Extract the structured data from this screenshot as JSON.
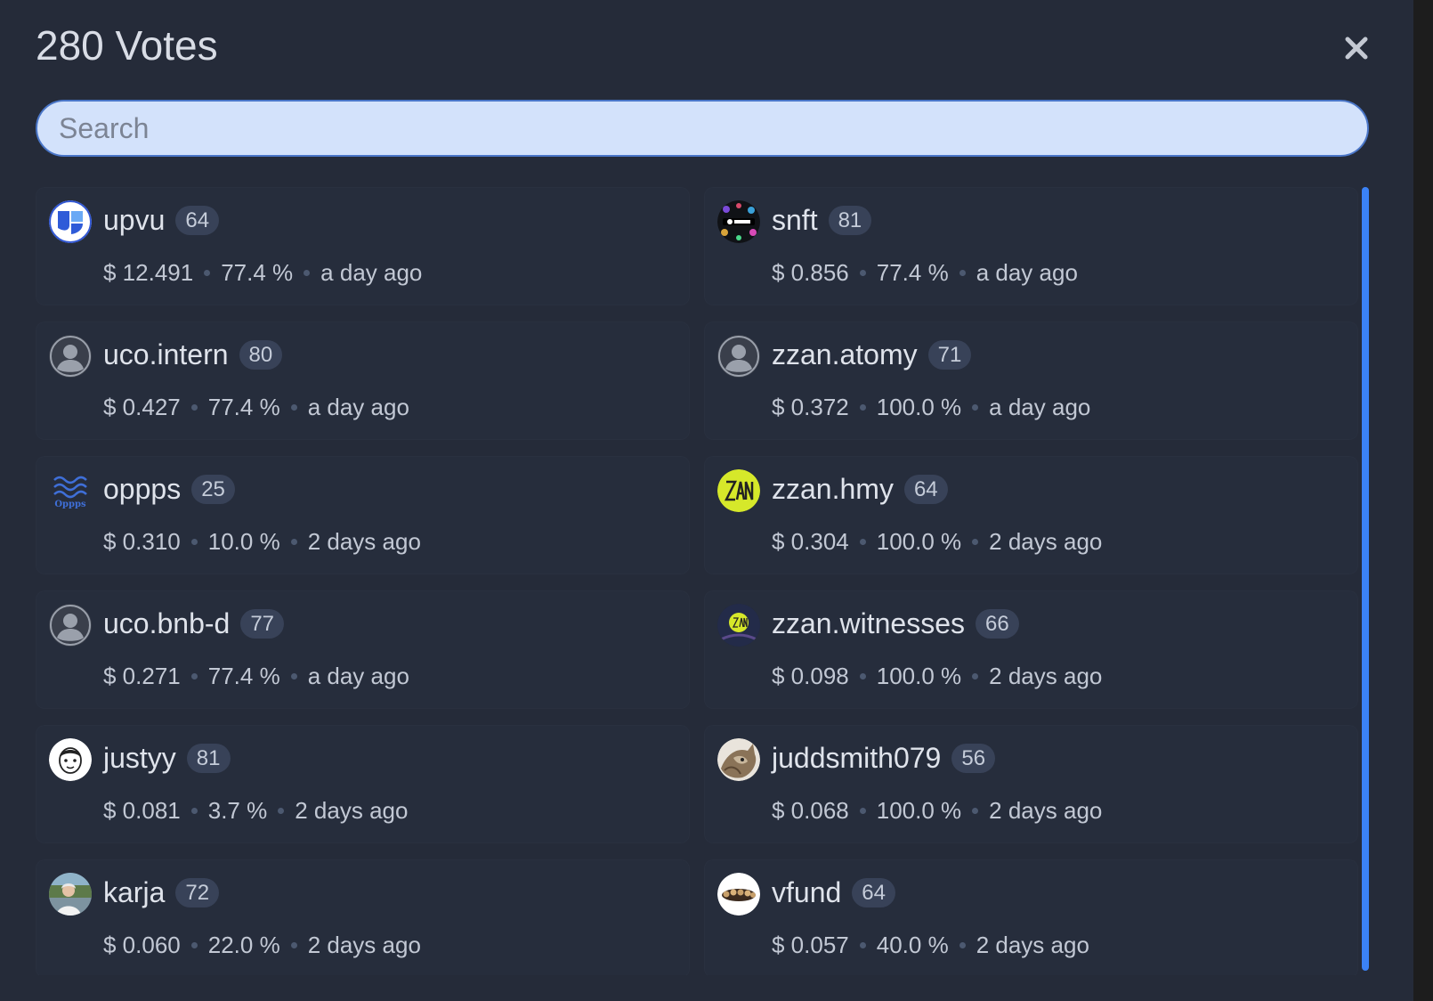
{
  "dialog": {
    "title": "280 Votes",
    "close_icon": "close-icon",
    "search_placeholder": "Search",
    "search_value": ""
  },
  "voters": [
    {
      "name": "upvu",
      "reputation": "64",
      "value": "$ 12.491",
      "percent": "77.4 %",
      "time": "a day ago",
      "avatar": "upvu-logo"
    },
    {
      "name": "snft",
      "reputation": "81",
      "value": "$ 0.856",
      "percent": "77.4 %",
      "time": "a day ago",
      "avatar": "snft-logo"
    },
    {
      "name": "uco.intern",
      "reputation": "80",
      "value": "$ 0.427",
      "percent": "77.4 %",
      "time": "a day ago",
      "avatar": "default-user-avatar"
    },
    {
      "name": "zzan.atomy",
      "reputation": "71",
      "value": "$ 0.372",
      "percent": "100.0 %",
      "time": "a day ago",
      "avatar": "default-user-avatar"
    },
    {
      "name": "oppps",
      "reputation": "25",
      "value": "$ 0.310",
      "percent": "10.0 %",
      "time": "2 days ago",
      "avatar": "oppps-logo",
      "avatar_text": "Oppps"
    },
    {
      "name": "zzan.hmy",
      "reputation": "64",
      "value": "$ 0.304",
      "percent": "100.0 %",
      "time": "2 days ago",
      "avatar": "zzan-logo"
    },
    {
      "name": "uco.bnb-d",
      "reputation": "77",
      "value": "$ 0.271",
      "percent": "77.4 %",
      "time": "a day ago",
      "avatar": "default-user-avatar"
    },
    {
      "name": "zzan.witnesses",
      "reputation": "66",
      "value": "$ 0.098",
      "percent": "100.0 %",
      "time": "2 days ago",
      "avatar": "zzan-witnesses-logo"
    },
    {
      "name": "justyy",
      "reputation": "81",
      "value": "$ 0.081",
      "percent": "3.7 %",
      "time": "2 days ago",
      "avatar": "cartoon-face-avatar"
    },
    {
      "name": "juddsmith079",
      "reputation": "56",
      "value": "$ 0.068",
      "percent": "100.0 %",
      "time": "2 days ago",
      "avatar": "cat-photo-avatar"
    },
    {
      "name": "karja",
      "reputation": "72",
      "value": "$ 0.060",
      "percent": "22.0 %",
      "time": "2 days ago",
      "avatar": "person-photo-avatar"
    },
    {
      "name": "vfund",
      "reputation": "64",
      "value": "$ 0.057",
      "percent": "40.0 %",
      "time": "2 days ago",
      "avatar": "vfund-logo"
    }
  ],
  "colors": {
    "background": "#252b39",
    "card": "#262d3c",
    "badge": "#384258",
    "accent": "#3b82f6",
    "search_fill": "#d3e2fb"
  }
}
